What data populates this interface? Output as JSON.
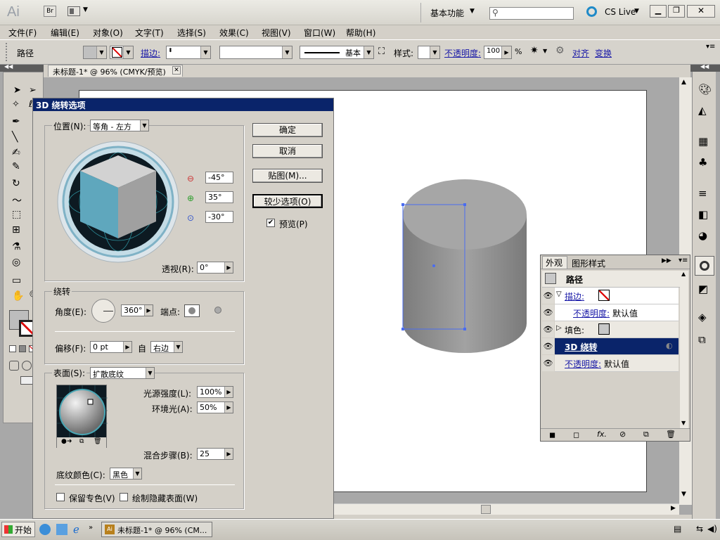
{
  "app": {
    "logo": "Ai",
    "bridge_label": "Br",
    "workspace": "基本功能",
    "search_placeholder": "",
    "cslive": "CS Live"
  },
  "menu": [
    "文件(F)",
    "编辑(E)",
    "对象(O)",
    "文字(T)",
    "选择(S)",
    "效果(C)",
    "视图(V)",
    "窗口(W)",
    "帮助(H)"
  ],
  "control": {
    "selection_label": "路径",
    "stroke_link": "描边:",
    "stroke_style": "基本",
    "style_label": "样式:",
    "opacity_link": "不透明度:",
    "opacity_value": "100",
    "opacity_unit": "%",
    "align_link": "对齐",
    "transform_link": "变换"
  },
  "document": {
    "tab_title": "未标题-1* @ 96% (CMYK/预览)"
  },
  "dialog": {
    "title": "3D 绕转选项",
    "position_label": "位置(N):",
    "position_value": "等角 - 左方",
    "rot_x": "-45°",
    "rot_y": "35°",
    "rot_z": "-30°",
    "perspective_label": "透视(R):",
    "perspective_value": "0°",
    "revolve_group": "绕转",
    "angle_label": "角度(E):",
    "angle_value": "360°",
    "cap_label": "端点:",
    "offset_label": "偏移(F):",
    "offset_value": "0 pt",
    "from_label": "自",
    "from_value": "右边",
    "surface_label": "表面(S):",
    "surface_value": "扩散底纹",
    "light_intensity_label": "光源强度(L):",
    "light_intensity_value": "100%",
    "ambient_label": "环境光(A):",
    "ambient_value": "50%",
    "blend_steps_label": "混合步骤(B):",
    "blend_steps_value": "25",
    "shading_color_label": "底纹颜色(C):",
    "shading_color_value": "黑色",
    "preserve_spot_label": "保留专色(V)",
    "draw_hidden_label": "绘制隐藏表面(W)",
    "ok_label": "确定",
    "cancel_label": "取消",
    "map_label": "贴图(M)...",
    "fewer_label": "较少选项(O)",
    "preview_label": "预览(P)",
    "preview_checked": true,
    "preserve_spot_checked": false,
    "draw_hidden_checked": false
  },
  "appearance": {
    "tab_active": "外观",
    "tab_other": "图形样式",
    "header": "路径",
    "rows": [
      {
        "label": "描边:",
        "link": true
      },
      {
        "label": "不透明度:",
        "value": "默认值",
        "link": true
      },
      {
        "label": "填色:",
        "link": false
      },
      {
        "label": "3D 绕转",
        "link": true
      },
      {
        "label": "不透明度:",
        "value": "默认值",
        "link": true
      }
    ]
  },
  "taskbar": {
    "start": "开始",
    "task": "未标题-1* @ 96% (CM..."
  },
  "colors": {
    "dialog_title_bg": "#0a246a",
    "cube_front": "#5fa7bd",
    "cylinder": "#9a9a9a",
    "selection": "#4a6cf0"
  }
}
